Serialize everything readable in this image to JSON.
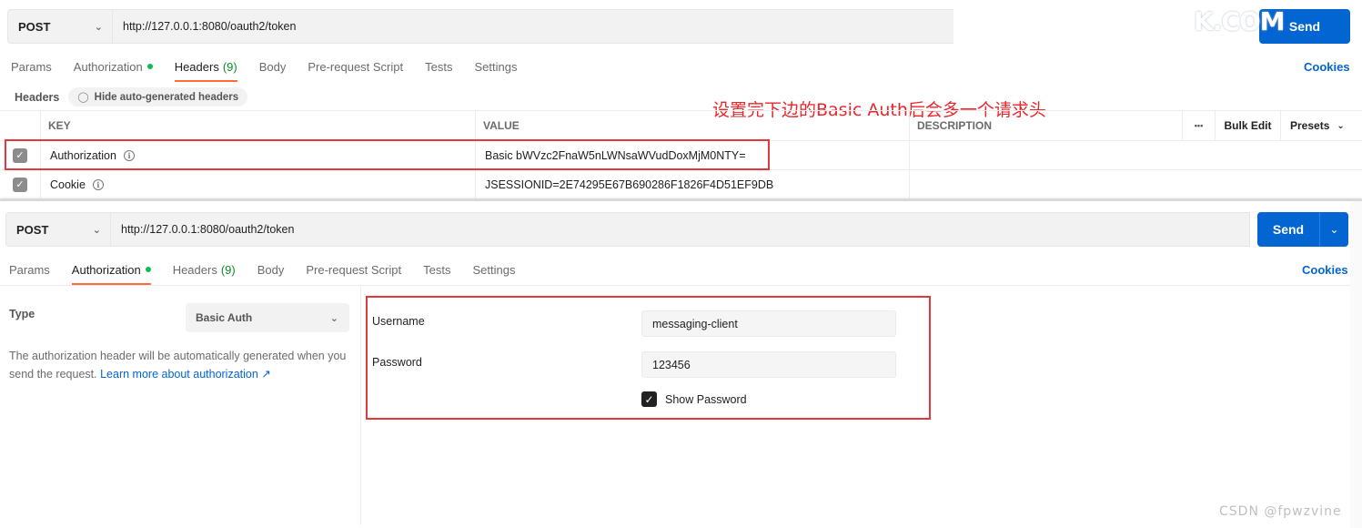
{
  "top": {
    "method": "POST",
    "url": "http://127.0.0.1:8080/oauth2/token",
    "send_label": "Send",
    "watermark": "K.COM",
    "tabs": [
      {
        "label": "Params",
        "active": false
      },
      {
        "label": "Authorization",
        "active": false,
        "dot": true
      },
      {
        "label": "Headers",
        "active": true,
        "count": "(9)"
      },
      {
        "label": "Body",
        "active": false
      },
      {
        "label": "Pre-request Script",
        "active": false
      },
      {
        "label": "Tests",
        "active": false
      },
      {
        "label": "Settings",
        "active": false
      }
    ],
    "cookies_label": "Cookies",
    "headers_label": "Headers",
    "hide_auto_label": "Hide auto-generated headers",
    "table": {
      "col_key": "KEY",
      "col_value": "VALUE",
      "col_description": "DESCRIPTION",
      "more_label": "•••",
      "bulk_edit_label": "Bulk Edit",
      "presets_label": "Presets",
      "rows": [
        {
          "key": "Authorization",
          "value": "Basic bWVzc2FnaW5nLWNsaWVudDoxMjM0NTY=",
          "checked": true
        },
        {
          "key": "Cookie",
          "value": "JSESSIONID=2E74295E67B690286F1826F4D51EF9DB",
          "checked": true
        }
      ]
    },
    "annotation": "设置完下边的Basic Auth后会多一个请求头"
  },
  "bottom": {
    "method": "POST",
    "url": "http://127.0.0.1:8080/oauth2/token",
    "send_label": "Send",
    "tabs": [
      {
        "label": "Params",
        "active": false
      },
      {
        "label": "Authorization",
        "active": true,
        "dot": true
      },
      {
        "label": "Headers",
        "active": false,
        "count": "(9)"
      },
      {
        "label": "Body",
        "active": false
      },
      {
        "label": "Pre-request Script",
        "active": false
      },
      {
        "label": "Tests",
        "active": false
      },
      {
        "label": "Settings",
        "active": false
      }
    ],
    "cookies_label": "Cookies",
    "type_label": "Type",
    "type_value": "Basic Auth",
    "type_desc": "The authorization header will be automatically generated when you send the request.",
    "learn_more": "Learn more about authorization ↗",
    "username_label": "Username",
    "username_value": "messaging-client",
    "password_label": "Password",
    "password_value": "123456",
    "show_password_label": "Show Password",
    "show_password_checked": true
  },
  "csdn_watermark": "CSDN @fpwzvine",
  "colors": {
    "send_blue": "#0265d2",
    "active_tab_underline": "#ff6c37",
    "status_dot_green": "#0cbb52",
    "annotation_red": "#e8262b"
  }
}
